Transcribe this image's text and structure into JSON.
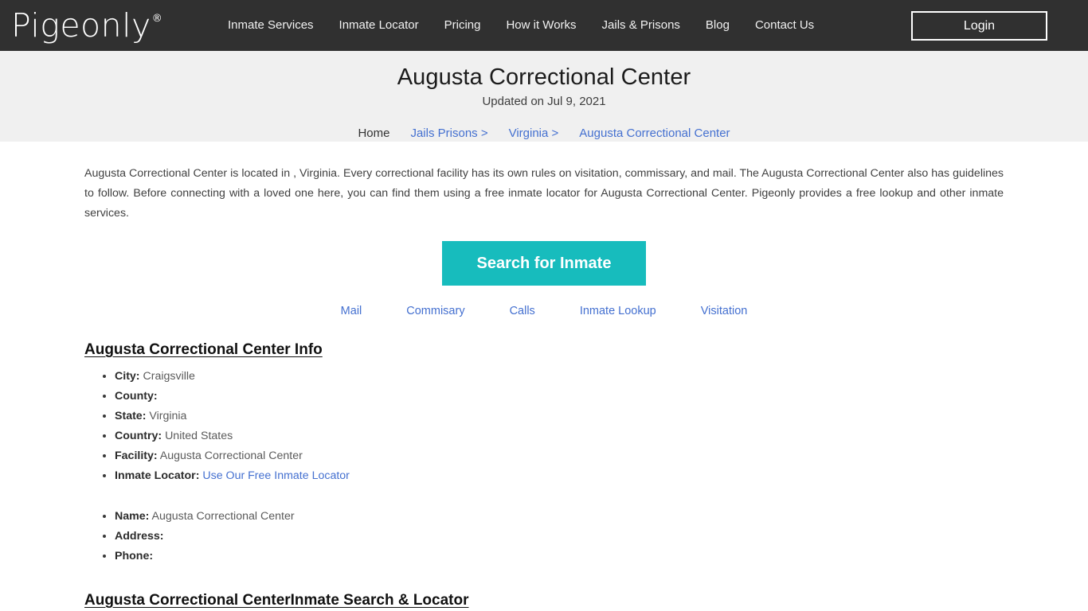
{
  "nav": {
    "logo_text": "Pigeonly",
    "logo_mark": "®",
    "items": [
      {
        "label": "Inmate Services"
      },
      {
        "label": "Inmate Locator"
      },
      {
        "label": "Pricing"
      },
      {
        "label": "How it Works"
      },
      {
        "label": "Jails & Prisons"
      },
      {
        "label": "Blog"
      },
      {
        "label": "Contact Us"
      }
    ],
    "login_label": "Login",
    "bar_color": "#303030"
  },
  "banner": {
    "title": "Augusta Correctional Center",
    "updated": "Updated on Jul 9, 2021",
    "background": "#f0f0f0",
    "breadcrumb": {
      "home": "Home",
      "links": [
        {
          "label": "Jails Prisons >"
        },
        {
          "label": "Virginia >"
        },
        {
          "label": "Augusta Correctional Center"
        }
      ],
      "link_color": "#4470d0"
    }
  },
  "main": {
    "intro": "Augusta Correctional Center is located in , Virginia. Every correctional facility has its own rules on visitation, commissary, and mail. The Augusta Correctional Center also has guidelines to follow. Before connecting with a loved one here, you can find them using a free inmate locator for Augusta Correctional Center. Pigeonly provides a free lookup and other inmate services.",
    "cta_label": "Search for Inmate",
    "cta_color": "#17bcbd",
    "quick_links": [
      {
        "label": "Mail"
      },
      {
        "label": "Commisary"
      },
      {
        "label": "Calls"
      },
      {
        "label": "Inmate Lookup"
      },
      {
        "label": "Visitation"
      }
    ],
    "info_heading": "Augusta Correctional Center Info",
    "info_items": [
      {
        "label": "City:",
        "value": "Craigsville",
        "is_link": false
      },
      {
        "label": "County:",
        "value": "",
        "is_link": false
      },
      {
        "label": "State:",
        "value": "Virginia",
        "is_link": false
      },
      {
        "label": "Country:",
        "value": "United States",
        "is_link": false
      },
      {
        "label": "Facility:",
        "value": "Augusta Correctional Center",
        "is_link": false
      },
      {
        "label": "Inmate Locator:",
        "value": "Use Our Free Inmate Locator",
        "is_link": true
      }
    ],
    "contact_items": [
      {
        "label": "Name:",
        "value": "Augusta Correctional Center"
      },
      {
        "label": "Address:",
        "value": ""
      },
      {
        "label": "Phone:",
        "value": ""
      }
    ],
    "search_heading": "Augusta Correctional CenterInmate Search & Locator"
  }
}
